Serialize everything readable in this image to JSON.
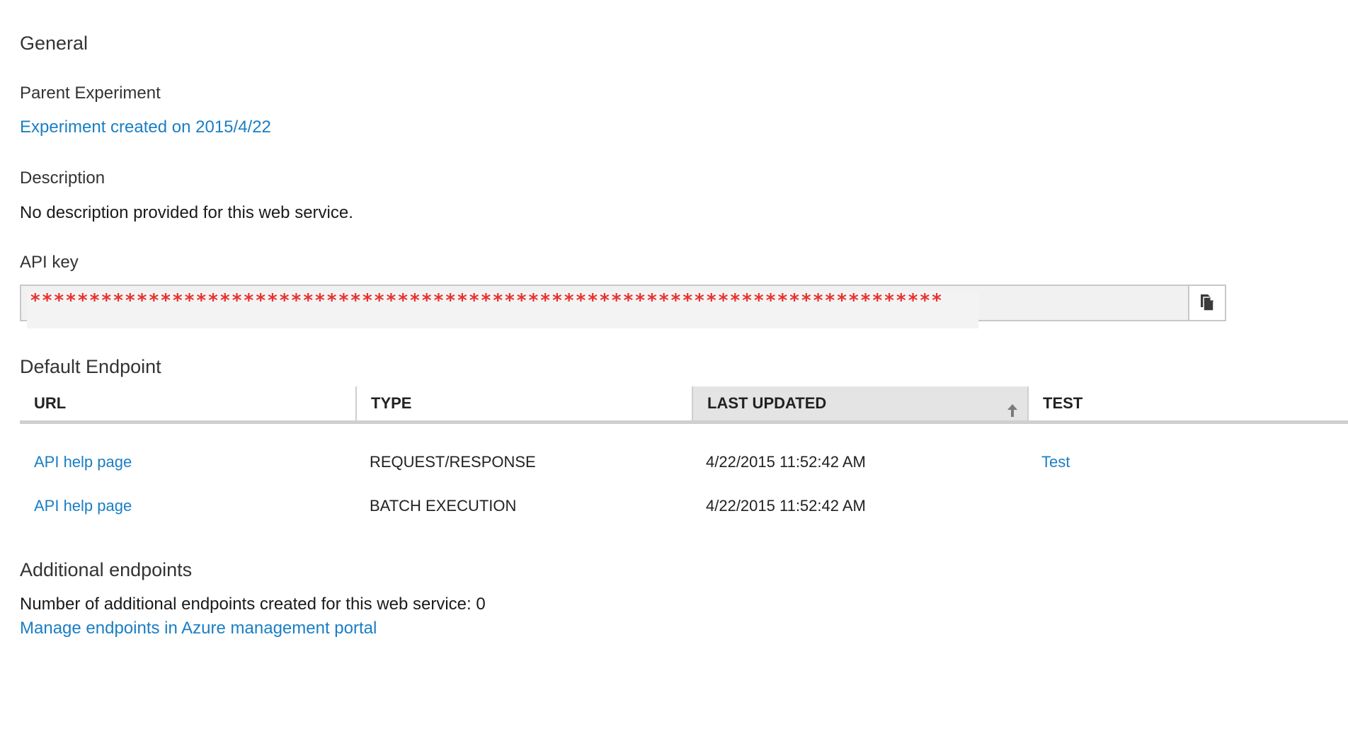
{
  "general": {
    "title": "General",
    "parent_experiment_label": "Parent Experiment",
    "parent_experiment_link": "Experiment created on 2015/4/22",
    "description_label": "Description",
    "description_value": "No description provided for this web service.",
    "api_key_label": "API key",
    "api_key_value": "*****************************************************************************",
    "copy_icon": "copy-icon"
  },
  "default_endpoint": {
    "title": "Default Endpoint",
    "columns": {
      "url": "URL",
      "type": "TYPE",
      "last_updated": "LAST UPDATED",
      "test": "TEST"
    },
    "sorted_column": "last_updated",
    "sort_direction": "ascending",
    "rows": [
      {
        "url": "API help page",
        "type": "REQUEST/RESPONSE",
        "last_updated": "4/22/2015 11:52:42 AM",
        "test": "Test"
      },
      {
        "url": "API help page",
        "type": "BATCH EXECUTION",
        "last_updated": "4/22/2015 11:52:42 AM",
        "test": ""
      }
    ]
  },
  "additional_endpoints": {
    "title": "Additional endpoints",
    "count_text": "Number of additional endpoints created for this web service: 0",
    "manage_link": "Manage endpoints in Azure management portal"
  },
  "colors": {
    "link": "#1a7ec4",
    "masked_key": "#e8322e",
    "header_sorted_bg": "#e4e4e4",
    "border": "#cfcfcf"
  }
}
